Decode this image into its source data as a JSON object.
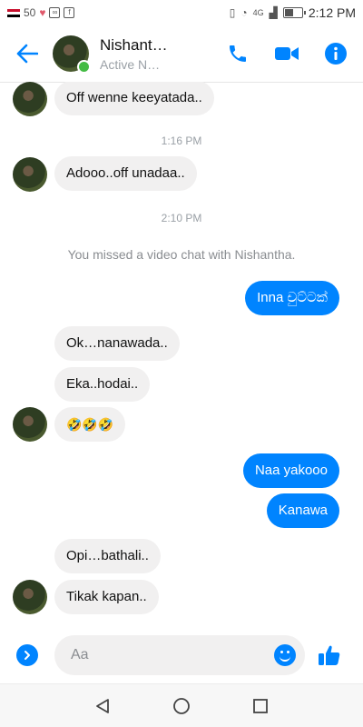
{
  "status_bar": {
    "left": {
      "signal_text": "50"
    },
    "right": {
      "network": "4G",
      "time": "2:12 PM"
    }
  },
  "header": {
    "contact_name": "Nishant…",
    "status": "Active N…"
  },
  "conversation": [
    {
      "type": "incoming",
      "text": "Off wenne keeyatada.."
    },
    {
      "type": "timestamp",
      "text": "1:16 PM"
    },
    {
      "type": "incoming",
      "text": "Adooo..off unadaa.."
    },
    {
      "type": "timestamp",
      "text": "2:10 PM"
    },
    {
      "type": "notice",
      "text": "You missed a video chat with Nishantha."
    },
    {
      "type": "outgoing",
      "text": "Inna චුට්ටක්"
    },
    {
      "type": "incoming",
      "text": "Ok…nanawada.."
    },
    {
      "type": "incoming",
      "text": "Eka..hodai.."
    },
    {
      "type": "incoming",
      "text": "🤣🤣🤣"
    },
    {
      "type": "outgoing",
      "text": "Naa yakooo"
    },
    {
      "type": "outgoing",
      "text": "Kanawa"
    },
    {
      "type": "incoming",
      "text": "Opi…bathali.."
    },
    {
      "type": "incoming",
      "text": "Tikak kapan.."
    }
  ],
  "composer": {
    "placeholder": "Aa"
  },
  "icons": {
    "back": "arrow-left",
    "call": "phone",
    "video": "video-camera",
    "info": "info-circle",
    "expand": "chevron-right",
    "emoji": "smiley",
    "like": "thumbs-up",
    "nav_back": "triangle-back",
    "nav_home": "circle-home",
    "nav_recent": "square-recent"
  },
  "colors": {
    "accent": "#0084ff",
    "incoming_bubble": "#f1f0f0",
    "online": "#44bb44"
  }
}
